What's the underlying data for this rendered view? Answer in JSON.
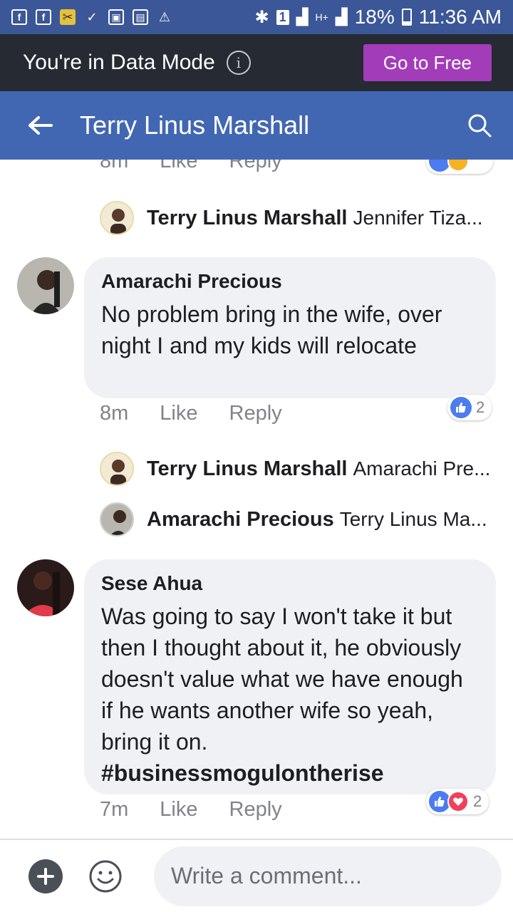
{
  "status_bar": {
    "battery": "18%",
    "time": "11:36 AM",
    "sim_slot": "1",
    "network": "H+"
  },
  "data_mode": {
    "text": "You're in Data Mode",
    "button": "Go to Free"
  },
  "header": {
    "title": "Terry Linus Marshall"
  },
  "comments": {
    "top_partial": {
      "time": "8m",
      "like": "Like",
      "reply": "Reply"
    },
    "reply1": {
      "name": "Terry Linus Marshall",
      "snippet": "Jennifer Tiza..."
    },
    "c1": {
      "author": "Amarachi Precious",
      "body": "No problem bring in the wife, over night I and my kids will relocate",
      "time": "8m",
      "like": "Like",
      "reply": "Reply",
      "reaction_count": "2"
    },
    "reply2": {
      "name": "Terry Linus Marshall",
      "snippet": "Amarachi Pre..."
    },
    "reply3": {
      "name": "Amarachi Precious",
      "snippet": "Terry Linus Ma..."
    },
    "c2": {
      "author": "Sese Ahua",
      "body": "Was going to say I won't take it but then I thought about it, he obviously doesn't value what we have enough if he wants another wife so yeah, bring it on.",
      "hashtag": "#businessmogulontherise",
      "time": "7m",
      "like": "Like",
      "reply": "Reply",
      "reaction_count": "2"
    }
  },
  "composer": {
    "placeholder": "Write a comment..."
  }
}
